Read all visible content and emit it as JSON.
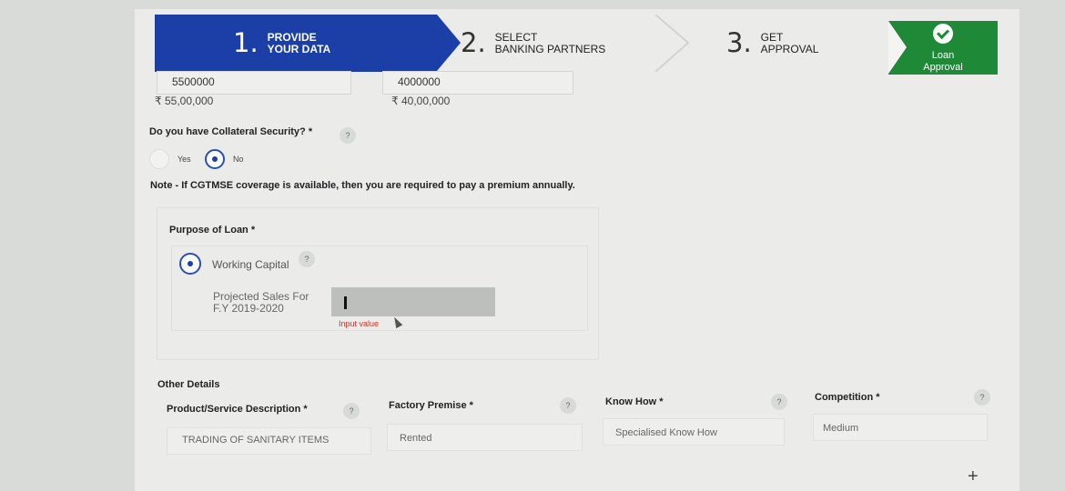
{
  "stepper": {
    "step1": {
      "number": "1.",
      "line1": "PROVIDE",
      "line2": "YOUR DATA"
    },
    "step2": {
      "number": "2.",
      "line1": "SELECT",
      "line2": "BANKING PARTNERS"
    },
    "step3": {
      "number": "3.",
      "line1": "GET",
      "line2": "APPROVAL"
    },
    "step4": {
      "line1": "Loan",
      "line2": "Approval"
    }
  },
  "amounts": {
    "first": {
      "value": "5500000",
      "formatted": "₹ 55,00,000"
    },
    "second": {
      "value": "4000000",
      "formatted": "₹ 40,00,000"
    }
  },
  "collateral": {
    "question": "Do you have Collateral Security? *",
    "help": "?",
    "yes_label": "Yes",
    "no_label": "No",
    "selected": "No"
  },
  "note": "Note - If CGTMSE coverage is available, then you are required to pay a premium annually.",
  "purpose": {
    "label": "Purpose of Loan *",
    "option": "Working Capital",
    "help": "?",
    "projected_label_1": "Projected Sales For",
    "projected_label_2": "F.Y 2019-2020",
    "input_value": "",
    "error": "Input value"
  },
  "other_details": {
    "heading": "Other Details",
    "fields": [
      {
        "label": "Product/Service Description *",
        "help": "?",
        "value": "TRADING OF SANITARY ITEMS"
      },
      {
        "label": "Factory Premise *",
        "help": "?",
        "value": "Rented"
      },
      {
        "label": "Know How *",
        "help": "?",
        "value": "Specialised Know How"
      },
      {
        "label": "Competition *",
        "help": "?",
        "value": "Medium"
      }
    ]
  },
  "icons": {
    "plus": "+"
  },
  "colors": {
    "primary": "#1b3fa6",
    "success": "#1e8a38",
    "error": "#c0392b"
  }
}
